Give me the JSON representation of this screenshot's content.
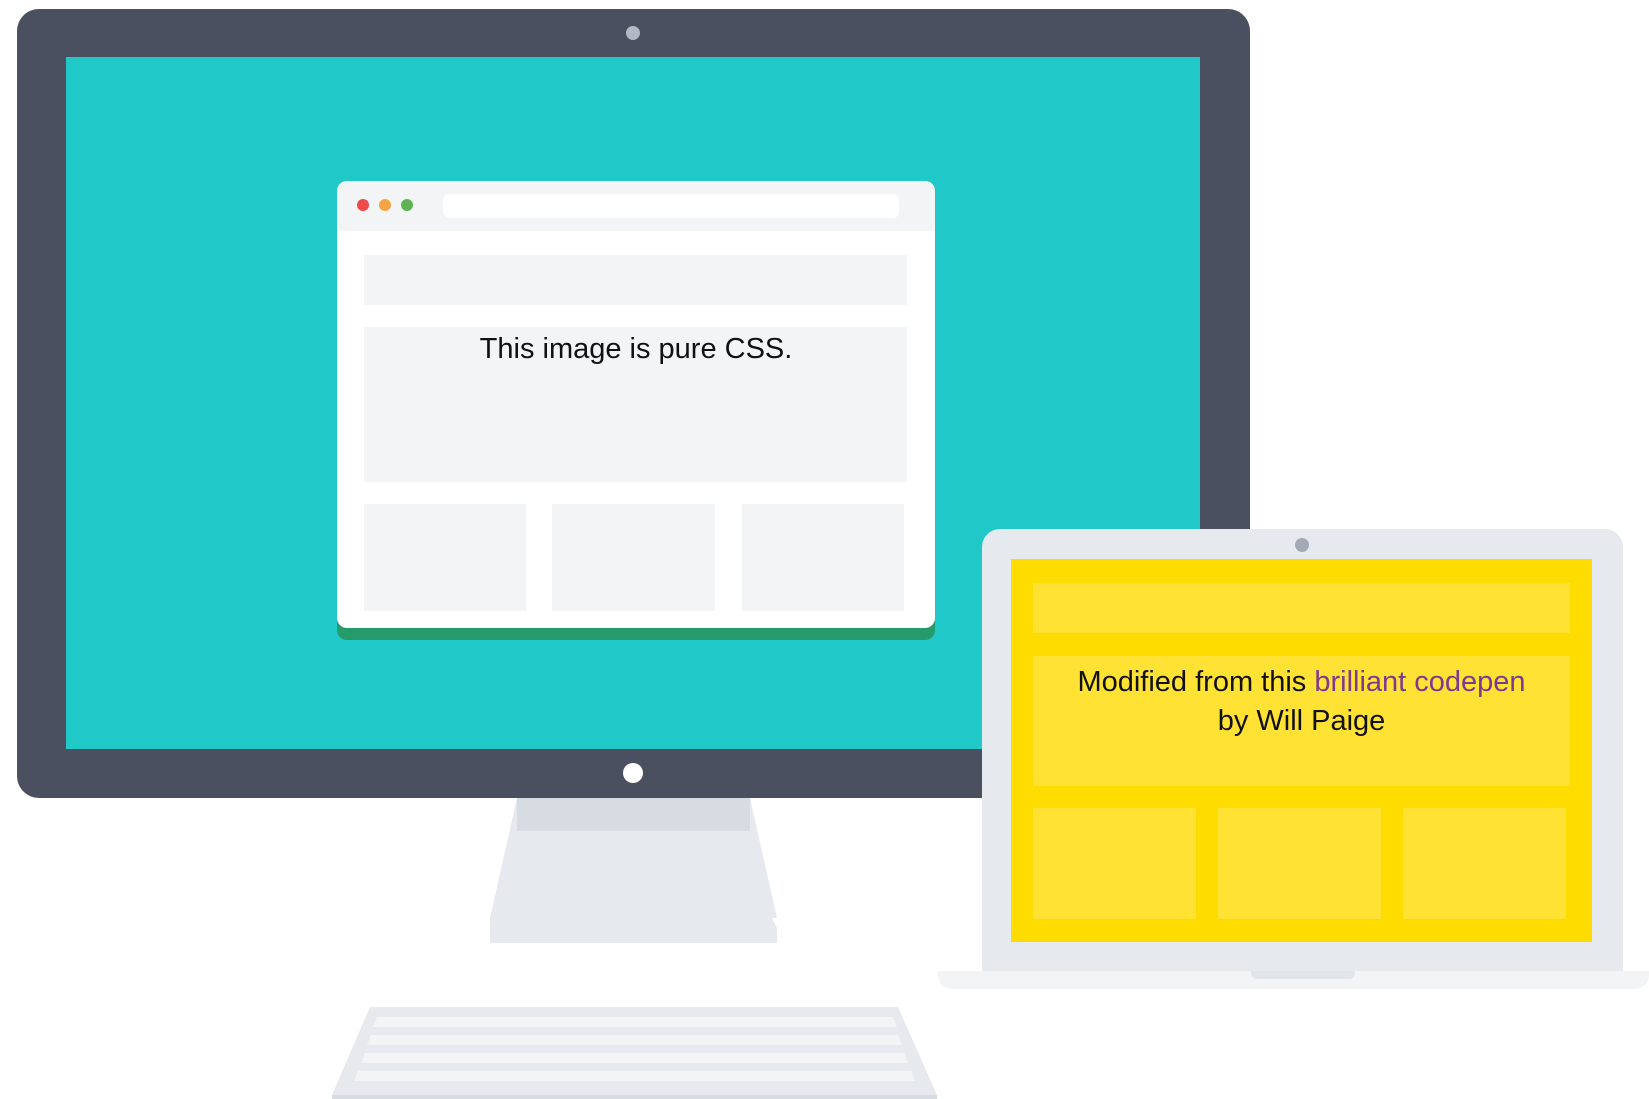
{
  "monitor": {
    "browser": {
      "hero_text": "This image is pure CSS."
    }
  },
  "laptop": {
    "text_before_link": "Modified from this ",
    "link_text": "brilliant codepen",
    "text_line2": "by Will Paige"
  },
  "colors": {
    "monitor_frame": "#4a5060",
    "monitor_screen": "#20c9c7",
    "browser_shadow": "#259a6b",
    "laptop_screen": "#ffdc00",
    "link": "#7b3b91"
  }
}
